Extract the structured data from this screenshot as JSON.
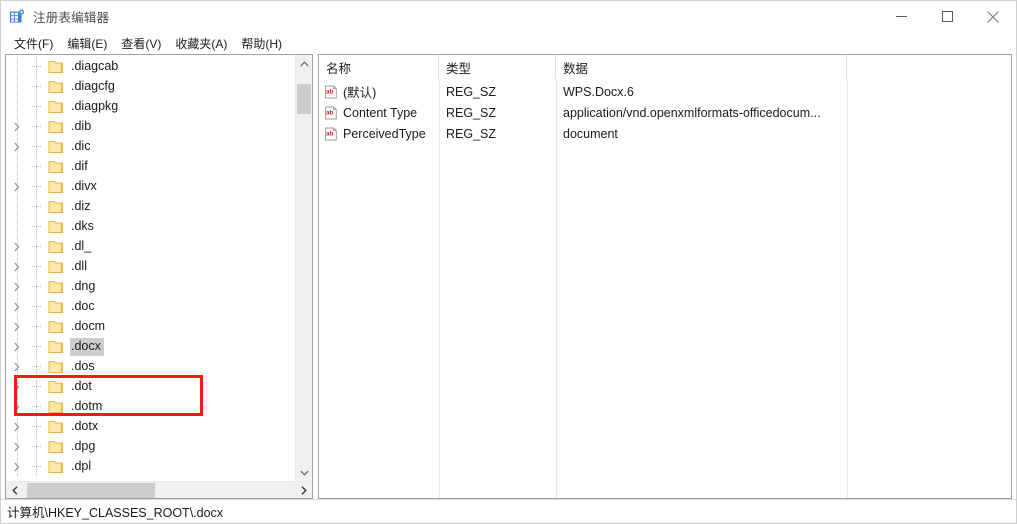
{
  "window": {
    "title": "注册表编辑器",
    "icon": "registry-editor-icon",
    "minimize_label": "最小化",
    "maximize_label": "最大化",
    "close_label": "关闭"
  },
  "menubar": {
    "items": [
      {
        "label": "文件(F)",
        "name": "menu-file"
      },
      {
        "label": "编辑(E)",
        "name": "menu-edit"
      },
      {
        "label": "查看(V)",
        "name": "menu-view"
      },
      {
        "label": "收藏夹(A)",
        "name": "menu-favorites"
      },
      {
        "label": "帮助(H)",
        "name": "menu-help"
      }
    ]
  },
  "tree": {
    "items": [
      {
        "label": ".diagcab",
        "expandable": false,
        "selected": false
      },
      {
        "label": ".diagcfg",
        "expandable": false,
        "selected": false
      },
      {
        "label": ".diagpkg",
        "expandable": false,
        "selected": false
      },
      {
        "label": ".dib",
        "expandable": true,
        "selected": false
      },
      {
        "label": ".dic",
        "expandable": true,
        "selected": false
      },
      {
        "label": ".dif",
        "expandable": false,
        "selected": false
      },
      {
        "label": ".divx",
        "expandable": true,
        "selected": false
      },
      {
        "label": ".diz",
        "expandable": false,
        "selected": false
      },
      {
        "label": ".dks",
        "expandable": false,
        "selected": false
      },
      {
        "label": ".dl_",
        "expandable": true,
        "selected": false
      },
      {
        "label": ".dll",
        "expandable": true,
        "selected": false
      },
      {
        "label": ".dng",
        "expandable": true,
        "selected": false
      },
      {
        "label": ".doc",
        "expandable": true,
        "selected": false
      },
      {
        "label": ".docm",
        "expandable": true,
        "selected": false
      },
      {
        "label": ".docx",
        "expandable": true,
        "selected": true
      },
      {
        "label": ".dos",
        "expandable": true,
        "selected": false
      },
      {
        "label": ".dot",
        "expandable": true,
        "selected": false
      },
      {
        "label": ".dotm",
        "expandable": true,
        "selected": false
      },
      {
        "label": ".dotx",
        "expandable": true,
        "selected": false
      },
      {
        "label": ".dpg",
        "expandable": true,
        "selected": false
      },
      {
        "label": ".dpl",
        "expandable": true,
        "selected": false
      }
    ],
    "scroll": {
      "up_icon": "chevron-up-icon",
      "down_icon": "chevron-down-icon",
      "left_icon": "chevron-left-icon",
      "right_icon": "chevron-right-icon"
    }
  },
  "list": {
    "columns": [
      "名称",
      "类型",
      "数据"
    ],
    "rows": [
      {
        "name": "(默认)",
        "type": "REG_SZ",
        "data": "WPS.Docx.6"
      },
      {
        "name": "Content Type",
        "type": "REG_SZ",
        "data": "application/vnd.openxmlformats-officedocum..."
      },
      {
        "name": "PerceivedType",
        "type": "REG_SZ",
        "data": "document"
      }
    ],
    "value_icon": "string-value-icon"
  },
  "statusbar": {
    "path": "计算机\\HKEY_CLASSES_ROOT\\.docx"
  },
  "annotation": {
    "color": "#ee1c17",
    "target": ".docx"
  },
  "colors": {
    "folder": "#fde9a9",
    "folder_edge": "#e3b84a",
    "selection": "#cdcdcd",
    "scroll_thumb": "#cdcdcd",
    "scroll_track": "#f0f0f0",
    "pane_border": "#a0a0a0",
    "accent_red": "#ee1c17"
  }
}
